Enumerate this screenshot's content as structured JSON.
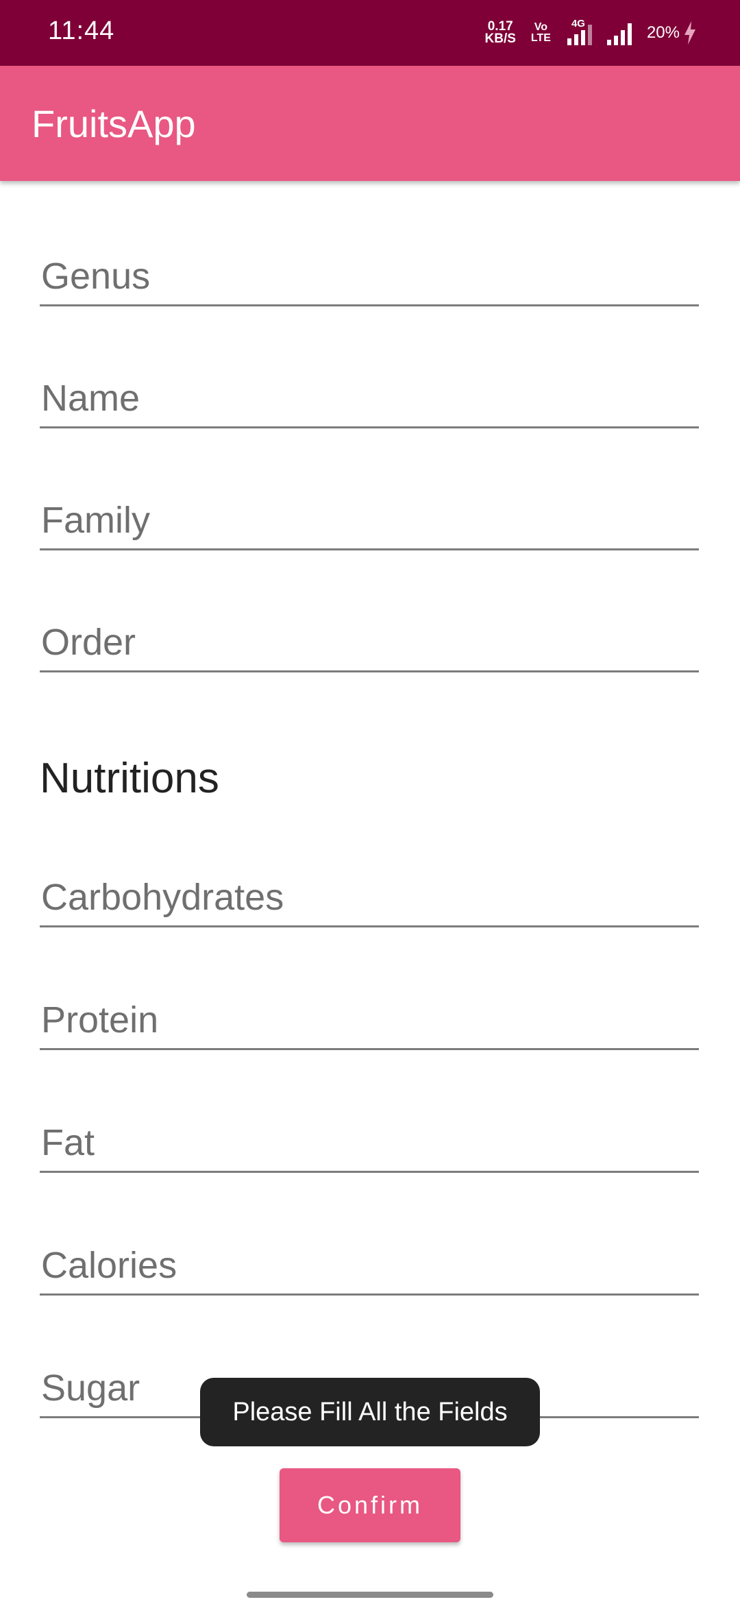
{
  "status_bar": {
    "time": "11:44",
    "net_speed_value": "0.17",
    "net_speed_unit": "KB/S",
    "volte_top": "Vo",
    "volte_bottom": "LTE",
    "network_type": "4G",
    "battery": "20%"
  },
  "app_bar": {
    "title": "FruitsApp"
  },
  "form": {
    "genus_placeholder": "Genus",
    "name_placeholder": "Name",
    "family_placeholder": "Family",
    "order_placeholder": "Order",
    "nutritions_title": "Nutritions",
    "carbohydrates_placeholder": "Carbohydrates",
    "protein_placeholder": "Protein",
    "fat_placeholder": "Fat",
    "calories_placeholder": "Calories",
    "sugar_placeholder": "Sugar"
  },
  "toast": {
    "message": "Please Fill All the Fields"
  },
  "actions": {
    "confirm_label": "Confirm"
  },
  "colors": {
    "status_bar": "#7f0037",
    "app_bar": "#e85882",
    "button": "#e85882",
    "toast": "#232323"
  }
}
